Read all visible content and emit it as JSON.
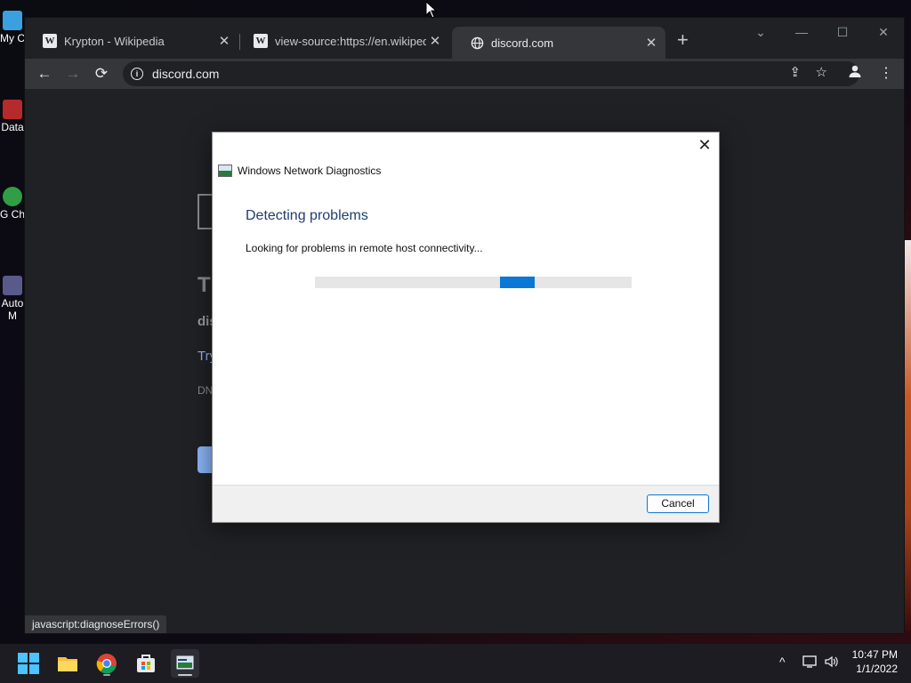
{
  "desktop": {
    "icons": [
      {
        "label": "My C",
        "icon": "computer-icon",
        "color": "#3ba0e0"
      },
      {
        "label": "Data",
        "icon": "shortcut-icon",
        "color": "#b52a2a"
      },
      {
        "label": "G Ch",
        "icon": "chrome-shortcut-icon",
        "color": "#2f9e44"
      },
      {
        "label": "Auto M",
        "icon": "shortcut-icon",
        "color": "#5a5a8a"
      }
    ]
  },
  "browser": {
    "tabs": [
      {
        "title": "Krypton - Wikipedia",
        "favicon": "W",
        "active": false
      },
      {
        "title": "view-source:https://en.wikipedia",
        "favicon": "W",
        "active": false
      },
      {
        "title": "discord.com",
        "favicon": "globe-icon",
        "active": true
      }
    ],
    "new_tab": "+",
    "window_controls": {
      "tab_search": "⌄",
      "minimize": "—",
      "maximize": "☐",
      "close": "✕"
    },
    "url": "discord.com",
    "status_text": "javascript:diagnoseErrors()",
    "page": {
      "title": "T",
      "subtitle": "dis",
      "link": "Try",
      "code": "DN"
    }
  },
  "dialog": {
    "title": "Windows Network Diagnostics",
    "heading": "Detecting problems",
    "message": "Looking for problems in remote host connectivity...",
    "progress_indeterminate": true,
    "cancel_label": "Cancel",
    "close_glyph": "✕"
  },
  "taskbar": {
    "apps": [
      "start-icon",
      "file-explorer-icon",
      "chrome-icon",
      "store-icon",
      "network-diagnostics-icon"
    ],
    "time": "10:47 PM",
    "date": "1/1/2022"
  },
  "colors": {
    "accent": "#0a78d4",
    "link": "#8ab4f8",
    "heading": "#1e3f6e"
  }
}
